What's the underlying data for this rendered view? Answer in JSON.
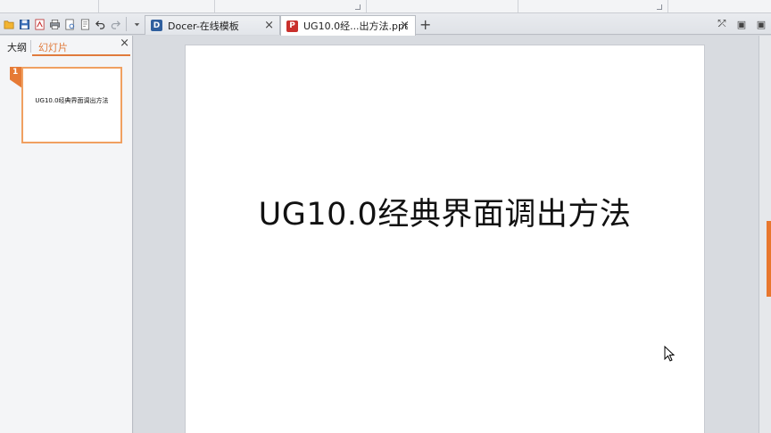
{
  "tabs": {
    "docer_label": "Docer-在线模板",
    "docer_icon": "D",
    "ppt_label": "UG10.0经...出方法.ppt",
    "ppt_icon": "P",
    "close_glyph": "×",
    "add_glyph": "+"
  },
  "left_pane": {
    "outline_tab": "大纲",
    "slides_tab": "幻灯片",
    "close_glyph": "×",
    "thumbnails": [
      {
        "number": "1",
        "title": "UG10.0经典界面调出方法"
      }
    ]
  },
  "slide": {
    "title": "UG10.0经典界面调出方法"
  },
  "right_controls": [
    "⤱",
    "▣",
    "▣"
  ],
  "colors": {
    "accent": "#e07b3c",
    "thumb_border": "#f0a061",
    "docer_icon_bg": "#2f5f9e",
    "ppt_icon_bg": "#c9302c"
  }
}
